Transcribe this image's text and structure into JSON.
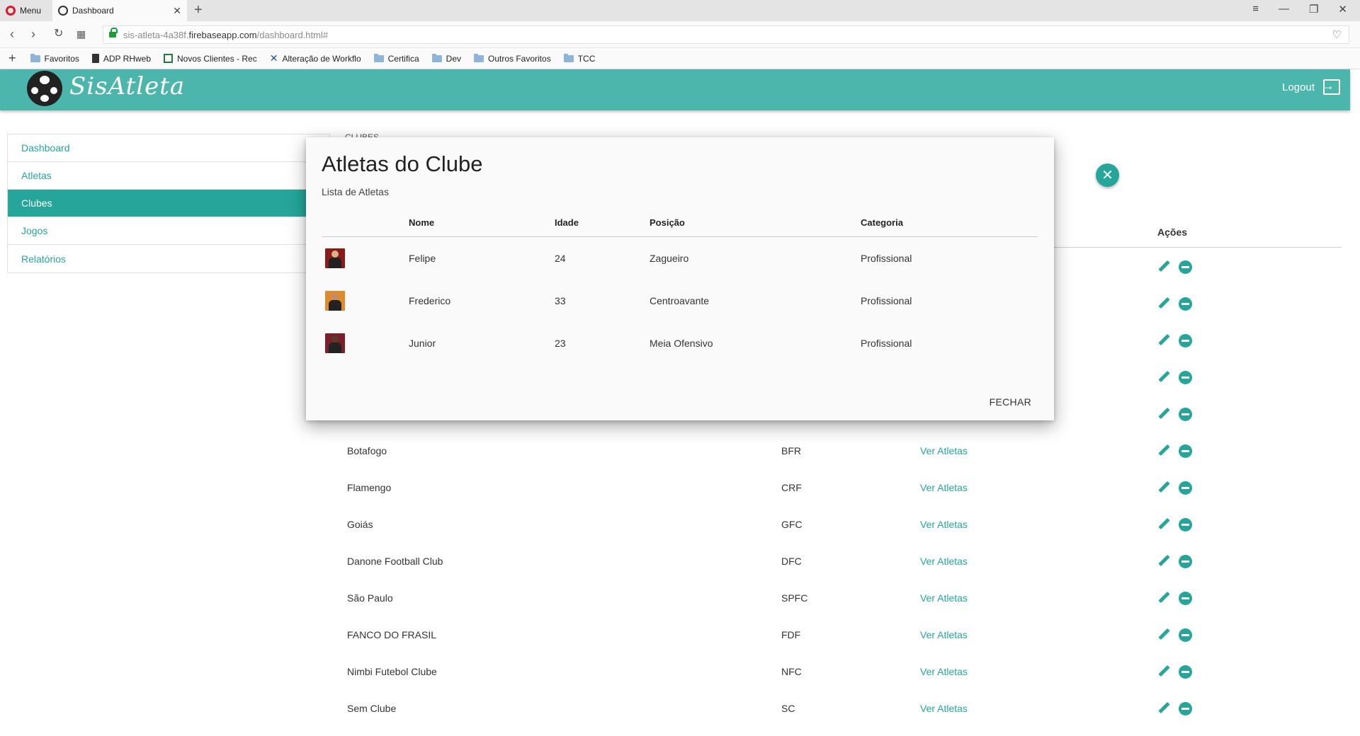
{
  "browser": {
    "menu_label": "Menu",
    "tab_title": "Dashboard",
    "url_prefix": "sis-atleta-4a38f.",
    "url_domain": "firebaseapp.com",
    "url_path": "/dashboard.html#",
    "bookmarks": [
      {
        "label": "Favoritos",
        "icon": "folder-icon"
      },
      {
        "label": "ADP RHweb",
        "icon": "document-icon"
      },
      {
        "label": "Novos Clientes - Rec",
        "icon": "spreadsheet-icon"
      },
      {
        "label": "Alteração de Workflo",
        "icon": "x-logo-icon"
      },
      {
        "label": "Certifica",
        "icon": "folder-icon"
      },
      {
        "label": "Dev",
        "icon": "folder-icon"
      },
      {
        "label": "Outros Favoritos",
        "icon": "folder-icon"
      },
      {
        "label": "TCC",
        "icon": "folder-icon"
      }
    ]
  },
  "app": {
    "logo_text": "SisAtleta",
    "logout_label": "Logout",
    "accent_color": "#26a69a",
    "header_color": "#4db6ac"
  },
  "sidebar": {
    "items": [
      {
        "label": "Dashboard",
        "active": false
      },
      {
        "label": "Atletas",
        "active": false
      },
      {
        "label": "Clubes",
        "active": true
      },
      {
        "label": "Jogos",
        "active": false
      },
      {
        "label": "Relatórios",
        "active": false
      }
    ]
  },
  "main": {
    "section_title": "CLUBES",
    "actions_header": "Ações",
    "rows": [
      {
        "name": "Botafogo",
        "sigla": "BFR",
        "link": "Ver Atletas"
      },
      {
        "name": "Flamengo",
        "sigla": "CRF",
        "link": "Ver Atletas"
      },
      {
        "name": "Goiás",
        "sigla": "GFC",
        "link": "Ver Atletas"
      },
      {
        "name": "Danone Football Club",
        "sigla": "DFC",
        "link": "Ver Atletas"
      },
      {
        "name": "São Paulo",
        "sigla": "SPFC",
        "link": "Ver Atletas"
      },
      {
        "name": "FANCO DO FRASIL",
        "sigla": "FDF",
        "link": "Ver Atletas"
      },
      {
        "name": "Nimbi Futebol Clube",
        "sigla": "NFC",
        "link": "Ver Atletas"
      },
      {
        "name": "Sem Clube",
        "sigla": "SC",
        "link": "Ver Atletas"
      }
    ]
  },
  "modal": {
    "title": "Atletas do Clube",
    "subtitle": "Lista de Atletas",
    "headers": [
      "",
      "Nome",
      "Idade",
      "Posição",
      "Categoria"
    ],
    "athletes": [
      {
        "name": "Felipe",
        "age": "24",
        "position": "Zagueiro",
        "category": "Profissional",
        "photo_colors": [
          "#8b1a1a",
          "#d9b38c"
        ]
      },
      {
        "name": "Frederico",
        "age": "33",
        "position": "Centroavante",
        "category": "Profissional",
        "photo_colors": [
          "#e08a2e",
          "#c48a6a"
        ]
      },
      {
        "name": "Junior",
        "age": "23",
        "position": "Meia Ofensivo",
        "category": "Profissional",
        "photo_colors": [
          "#7a1f2b",
          "#5a3a2a"
        ]
      }
    ],
    "close_label": "FECHAR",
    "close_icon": "close-icon"
  }
}
